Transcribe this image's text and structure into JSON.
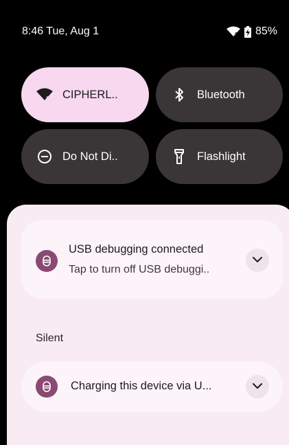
{
  "status_bar": {
    "time_date": "8:46 Tue, Aug 1",
    "battery_percent": "85%",
    "wifi_icon": "wifi-5-icon",
    "battery_icon": "battery-charging-icon"
  },
  "quick_settings": {
    "tiles": [
      {
        "label": "CIPHERL..",
        "icon": "wifi-5-icon",
        "active": true
      },
      {
        "label": "Bluetooth",
        "icon": "bluetooth-icon",
        "active": false
      },
      {
        "label": "Do Not Di..",
        "icon": "do-not-disturb-icon",
        "active": false
      },
      {
        "label": "Flashlight",
        "icon": "flashlight-icon",
        "active": false
      }
    ]
  },
  "notifications": {
    "usb_debugging": {
      "title": "USB debugging connected",
      "text": "Tap to turn off USB debuggi..",
      "icon": "usb-app-icon"
    },
    "silent_header": "Silent",
    "charging": {
      "title": "Charging this device via U...",
      "icon": "usb-app-icon"
    }
  },
  "colors": {
    "active_tile": "#f7d8ee",
    "inactive_tile": "#3a3537",
    "shade_background": "#f8ebf1",
    "app_icon": "#8a4a72"
  }
}
